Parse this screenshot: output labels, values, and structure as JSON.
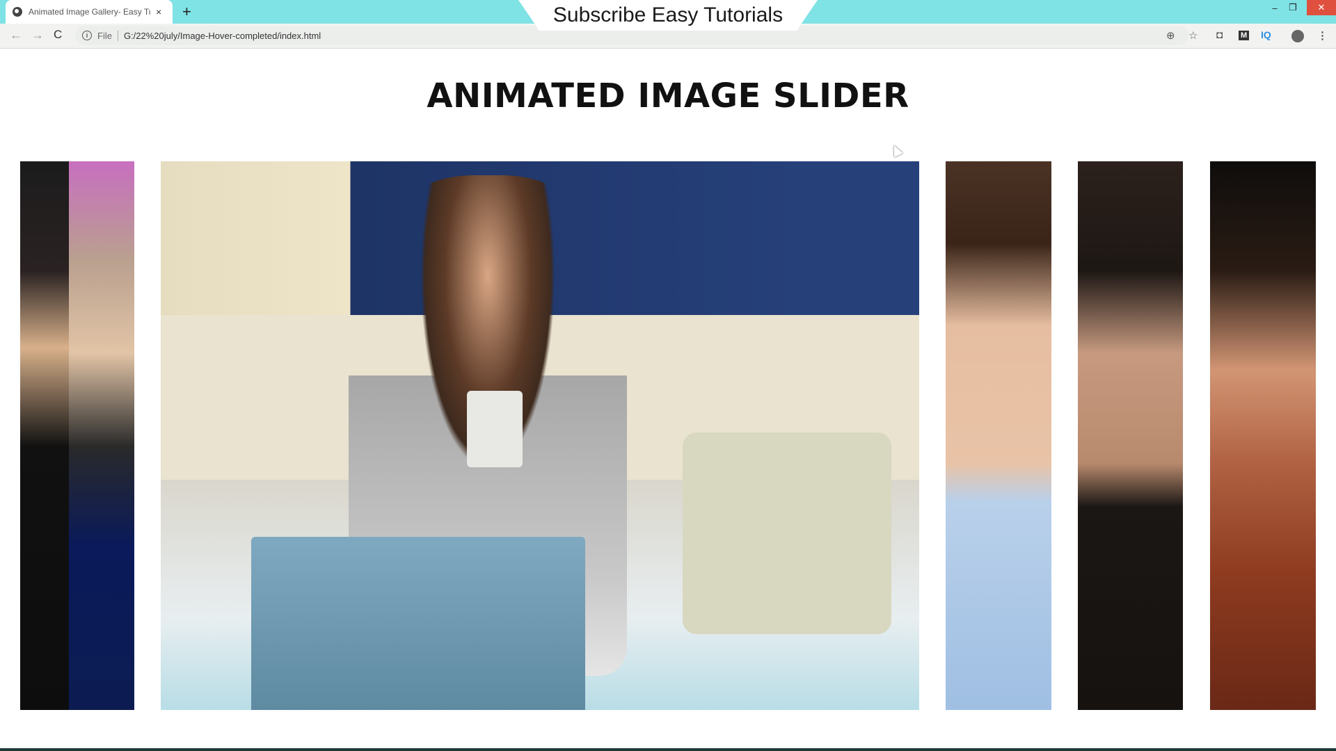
{
  "browser": {
    "tab": {
      "title": "Animated Image Gallery- Easy Tu",
      "favicon": "globe-icon",
      "close_icon": "×"
    },
    "new_tab_icon": "+",
    "window_controls": {
      "minimize": "–",
      "maximize": "❐",
      "close": "✕"
    },
    "nav": {
      "back": "←",
      "forward": "→",
      "reload": "C"
    },
    "address": {
      "info_icon": "i",
      "scheme_label": "File",
      "url": "G:/22%20july/Image-Hover-completed/index.html"
    },
    "toolbar_icons": {
      "zoom": "⊕",
      "star": "☆",
      "camera": "◘",
      "m_ext": "M",
      "iq_ext": "IQ",
      "menu": "⋮"
    }
  },
  "overlay_banner": {
    "text": "Subscribe Easy Tutorials"
  },
  "page": {
    "heading": "ANIMATED IMAGE SLIDER",
    "slides": [
      {
        "name": "man-vr-headset",
        "expanded": false
      },
      {
        "name": "woman-laptop-coffee",
        "expanded": true
      },
      {
        "name": "woman-striped-shirt",
        "expanded": false
      },
      {
        "name": "man-hat-wink",
        "expanded": false
      },
      {
        "name": "woman-red-hair-hat",
        "expanded": false
      }
    ]
  },
  "colors": {
    "tabbar": "#7fe2e4",
    "close_button": "#e0503f",
    "taskbar": "#1f3a36"
  }
}
